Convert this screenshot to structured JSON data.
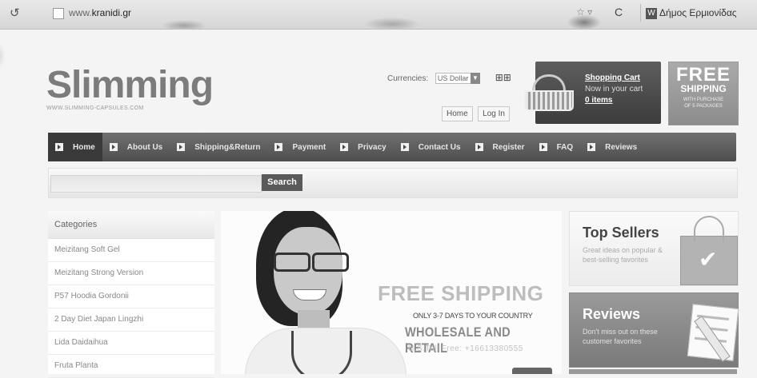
{
  "browser": {
    "url_prefix": "www.",
    "url_host": "kranidi.gr",
    "search_text": "Δήμος Ερμιονίδας",
    "search_engine_badge": "W",
    "reload_glyph": "C",
    "nav_glyph": "↺",
    "right_ctl_glyph": "☆ ▿"
  },
  "header": {
    "logo_text": "Slimming",
    "logo_sub": "WWW.SLIMMING-CAPSULES.COM",
    "currencies_label": "Currencies:",
    "currency_value": "US Dollar",
    "currency_arrow": "▼",
    "grid_glyph": "⊞⊞",
    "home_link": "Home",
    "login_link": "Log In",
    "cart_title": "Shopping Cart",
    "cart_subtitle": "Now in your cart",
    "cart_items": "0 items",
    "free_big": "FREE",
    "free_mid": "SHIPPING",
    "free_small_1": "WITH PURCHASE",
    "free_small_2": "OF 5 PACKAGES"
  },
  "nav": {
    "items": [
      {
        "label": "Home"
      },
      {
        "label": "About Us"
      },
      {
        "label": "Shipping&Return"
      },
      {
        "label": "Payment"
      },
      {
        "label": "Privacy"
      },
      {
        "label": "Contact Us"
      },
      {
        "label": "Register"
      },
      {
        "label": "FAQ"
      },
      {
        "label": "Reviews"
      }
    ]
  },
  "search": {
    "button_label": "Search",
    "value": ""
  },
  "sidebar": {
    "heading": "Categories",
    "items": [
      {
        "label": "Meizitang Soft Gel"
      },
      {
        "label": "Meizitang Strong Version"
      },
      {
        "label": "P57 Hoodia Gordonii"
      },
      {
        "label": "2 Day Diet Japan Lingzhi"
      },
      {
        "label": "Lida Daidaihua"
      },
      {
        "label": "Fruta Planta"
      }
    ]
  },
  "banner": {
    "headline": "FREE SHIPPING",
    "line2": "ONLY 3-7 DAYS TO YOUR COUNTRY",
    "line3": "WHOLESALE AND RETAIL",
    "line4": "U.S.Toll Free: +16613380555"
  },
  "right": {
    "topsellers_title": "Top Sellers",
    "topsellers_desc": "Great ideas on popular & best-selling favorites",
    "topsellers_check": "✔",
    "reviews_title": "Reviews",
    "reviews_desc": "Don't miss out on these customer favorites"
  },
  "colors": {
    "nav_bg": "#5e5e5e",
    "cart_bg": "#4a4a4a",
    "free_bg": "#9a9a9a"
  }
}
